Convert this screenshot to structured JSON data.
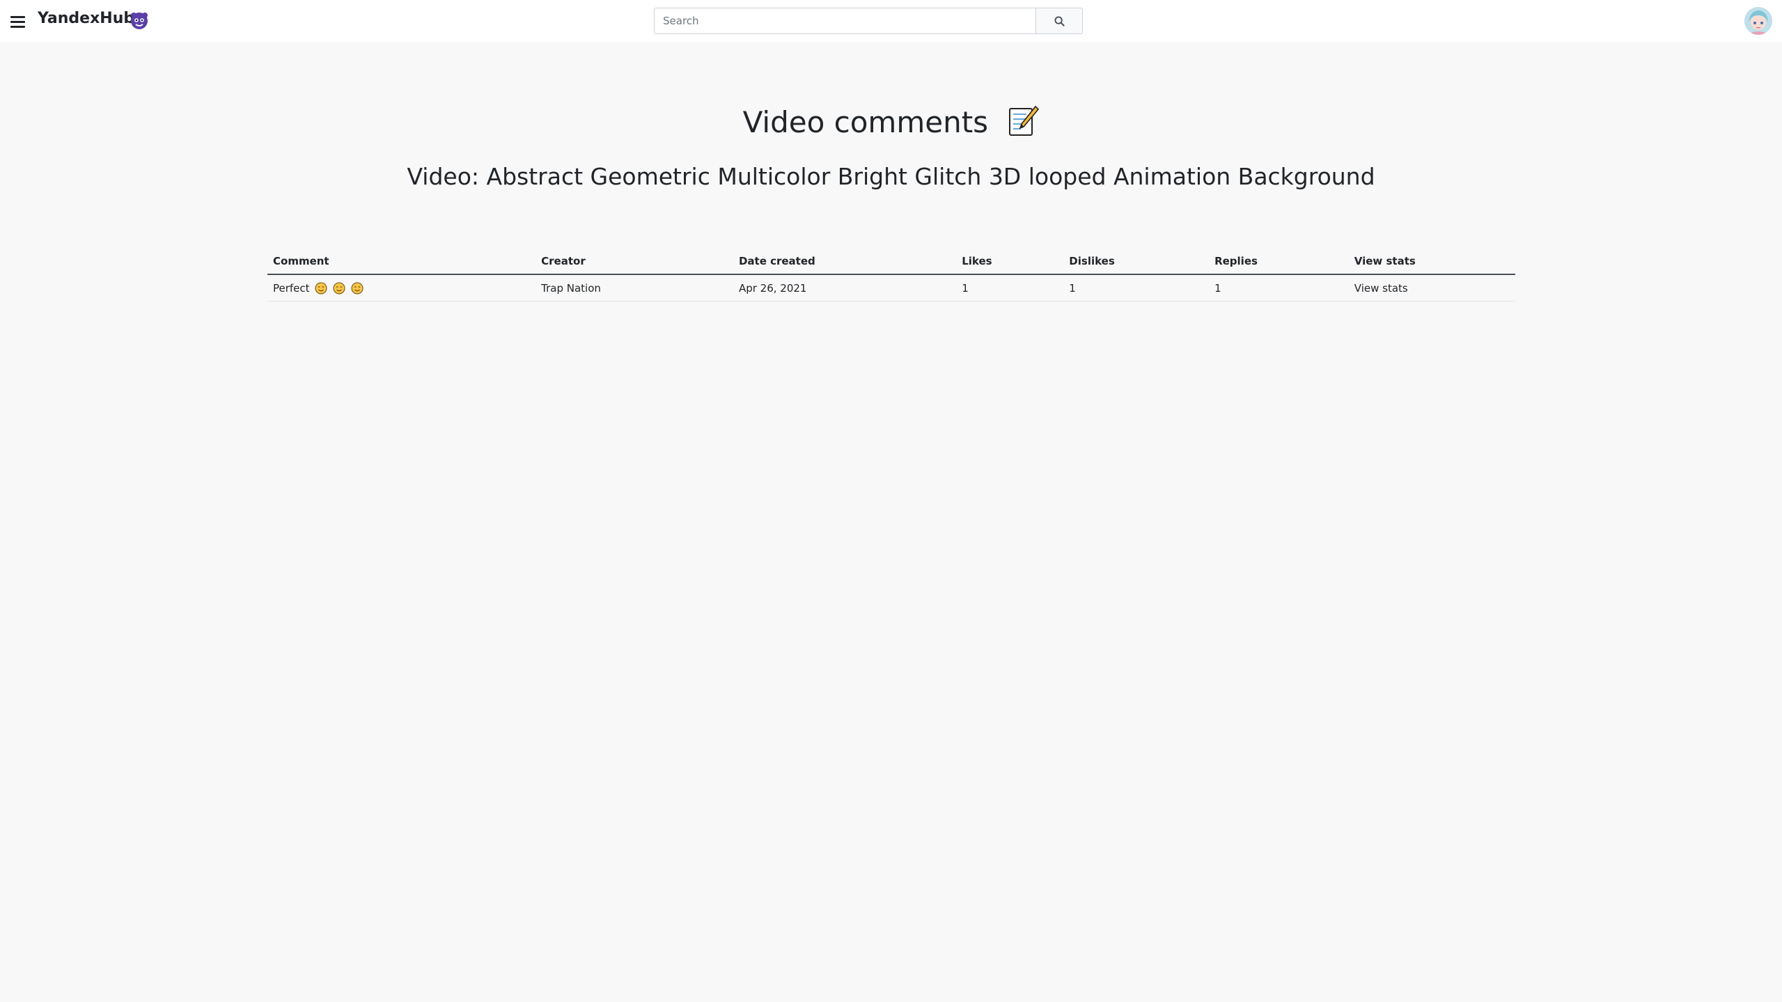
{
  "header": {
    "brand": "YandexHub",
    "brand_icon": "purple-hub-logo-icon",
    "search": {
      "placeholder": "Search",
      "value": ""
    },
    "menu_icon": "hamburger-menu-icon",
    "search_icon": "magnifier-icon",
    "avatar_icon": "user-avatar-icon"
  },
  "page": {
    "title": "Video comments",
    "title_icon": "memo-emoji-icon",
    "video_title": "Video: Abstract Geometric Multicolor Bright Glitch 3D looped Animation Background"
  },
  "table": {
    "columns": [
      "Comment",
      "Creator",
      "Date created",
      "Likes",
      "Dislikes",
      "Replies",
      "View stats"
    ],
    "rows": [
      {
        "comment": "Perfect",
        "comment_emojis": [
          "smiling-face-icon",
          "smiling-face-icon",
          "smiling-face-icon"
        ],
        "creator": "Trap Nation",
        "date": "Apr 26, 2021",
        "likes": "1",
        "dislikes": "1",
        "replies": "1",
        "stats": "View stats"
      }
    ]
  },
  "colors": {
    "background": "#f8f8f8",
    "header_bg": "#ffffff",
    "text": "#212529",
    "brand_icon": "#5b3fa8"
  }
}
